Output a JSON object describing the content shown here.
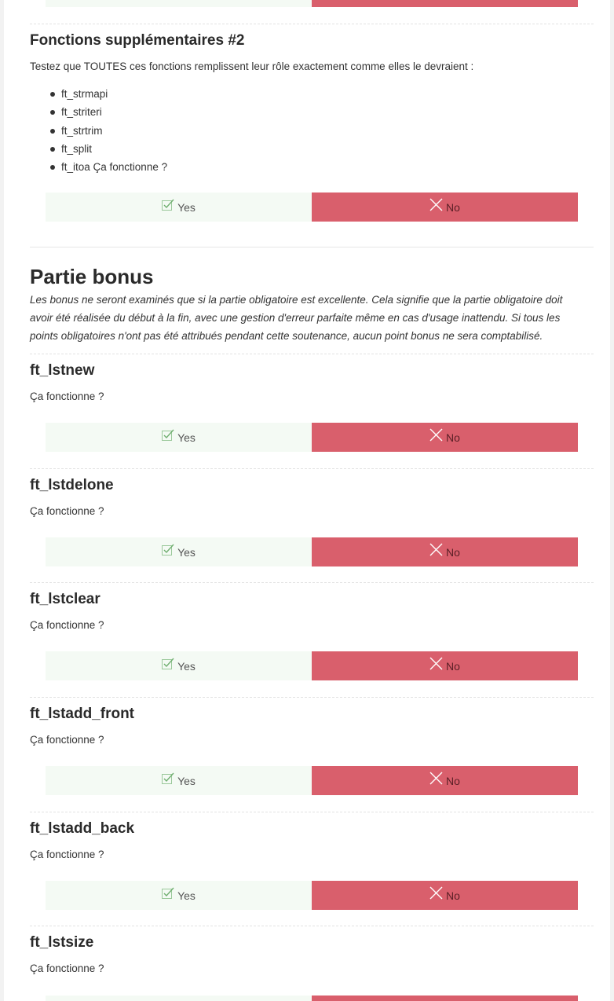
{
  "buttons": {
    "yes_label": "Yes",
    "no_label": "No"
  },
  "extra_functions_2": {
    "title": "Fonctions supplémentaires #2",
    "description": "Testez que TOUTES ces fonctions remplissent leur rôle exactement comme elles le devraient :",
    "items": [
      "ft_strmapi",
      "ft_striteri",
      "ft_strtrim",
      "ft_split",
      "ft_itoa Ça fonctionne ?"
    ]
  },
  "bonus": {
    "title": "Partie bonus",
    "intro_lines": [
      "Les bonus ne seront examinés que si la partie obligatoire est excellente. Cela signifie que la partie obligatoire doit",
      "avoir été réalisée du début à la fin, avec une gestion d'erreur parfaite même en cas d'usage inattendu. Si tous les",
      "points obligatoires n'ont pas été attribués pendant cette soutenance, aucun point bonus ne sera comptabilisé."
    ]
  },
  "sections": [
    {
      "title": "ft_lstnew",
      "question": "Ça fonctionne ?"
    },
    {
      "title": "ft_lstdelone",
      "question": "Ça fonctionne ?"
    },
    {
      "title": "ft_lstclear",
      "question": "Ça fonctionne ?"
    },
    {
      "title": "ft_lstadd_front",
      "question": "Ça fonctionne ?"
    },
    {
      "title": "ft_lstadd_back",
      "question": "Ça fonctionne ?"
    },
    {
      "title": "ft_lstsize",
      "question": "Ça fonctionne ?"
    }
  ],
  "icons": {
    "yes": "check-icon",
    "no": "cross-icon"
  },
  "colors": {
    "yes_bg": "#f4faf4",
    "no_bg": "#d95f6c",
    "yes_icon": "#7cb87c",
    "no_icon": "#ffffff"
  }
}
